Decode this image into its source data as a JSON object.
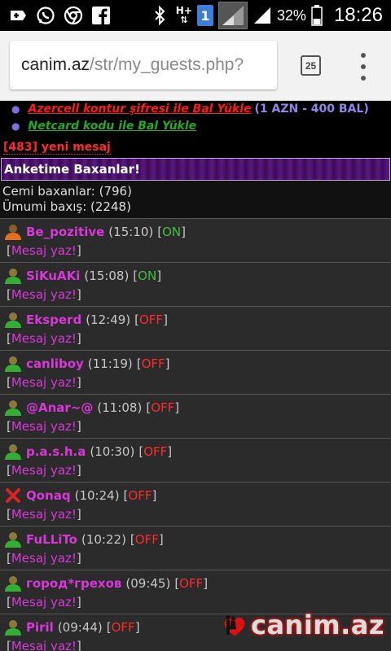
{
  "status_bar": {
    "icons_left": [
      "add-icon",
      "whatsapp-icon",
      "chrome-icon",
      "facebook-icon"
    ],
    "icons_right": [
      "bluetooth-icon",
      "network-type-icon",
      "sim-icon",
      "signal-icon",
      "signal-icon",
      "battery-icon"
    ],
    "network_type": "H+",
    "sim_number": "1",
    "battery_percent": "32%",
    "time": "18:26"
  },
  "browser": {
    "url_host": "canim.az",
    "url_path": "/str/my_guests.php?",
    "tab_count": "25"
  },
  "promo": {
    "item1_link": "Azercell kontur şifresi ile Bal Yükle",
    "item1_note": "(1 AZN - 400 BAL)",
    "item2_link": "Netcard kodu ile Bal Yükle"
  },
  "new_messages": "[483] yeni mesaj",
  "section_title": "Anketime Baxanlar!",
  "stats": {
    "total_viewers": "Cemi baxanlar: (796)",
    "total_views": "Ümumi baxış: (2248)"
  },
  "guests": [
    {
      "name": "Be_pozitive",
      "time": "(15:10)",
      "status": "ON",
      "avatar": "orange-user-icon",
      "message_label": "Mesaj yaz!"
    },
    {
      "name": "SiKuAKi",
      "time": "(15:08)",
      "status": "ON",
      "avatar": "green-user-icon",
      "message_label": "Mesaj yaz!"
    },
    {
      "name": "Eksperd",
      "time": "(12:49)",
      "status": "OFF",
      "avatar": "green-user-icon",
      "message_label": "Mesaj yaz!"
    },
    {
      "name": "canliboy",
      "time": "(11:19)",
      "status": "OFF",
      "avatar": "green-user-icon",
      "message_label": "Mesaj yaz!"
    },
    {
      "name": "@Anar~@",
      "time": "(11:08)",
      "status": "OFF",
      "avatar": "green-user-icon",
      "message_label": "Mesaj yaz!"
    },
    {
      "name": "p.a.s.h.a",
      "time": "(10:30)",
      "status": "OFF",
      "avatar": "green-user-icon",
      "message_label": "Mesaj yaz!"
    },
    {
      "name": "Qonaq",
      "time": "(10:24)",
      "status": "OFF",
      "avatar": "red-x-icon",
      "message_label": "Mesaj yaz!"
    },
    {
      "name": "FuLLiTo",
      "time": "(10:22)",
      "status": "OFF",
      "avatar": "green-user-icon",
      "message_label": "Mesaj yaz!"
    },
    {
      "name": "город*грехов",
      "time": "(09:45)",
      "status": "OFF",
      "avatar": "green-user-icon",
      "message_label": "Mesaj yaz!"
    },
    {
      "name": "Piril",
      "time": "(09:44)",
      "status": "OFF",
      "avatar": "green-user-icon",
      "message_label": "Mesaj yaz!"
    }
  ],
  "logo_text": "canim.az",
  "colors": {
    "name": "#d838d8",
    "online": "#3fbf3f",
    "offline": "#ff2a2a",
    "row_bg": "#2b2b2b"
  }
}
